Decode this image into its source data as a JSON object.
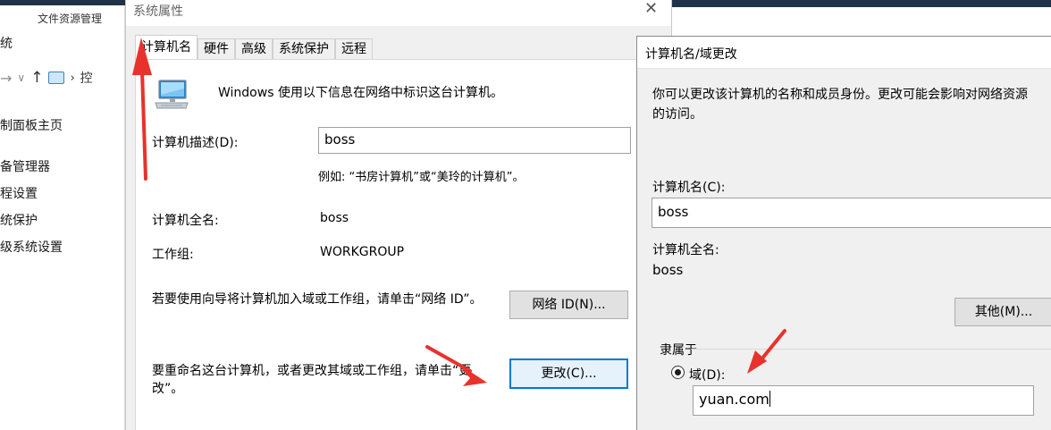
{
  "background": {
    "tab_title": "文件资源管理",
    "title": "统",
    "breadcrumb": "控",
    "links": [
      "制面板主页",
      "备管理器",
      "程设置",
      "统保护",
      "级系统设置"
    ]
  },
  "system_properties": {
    "title": "系统属性",
    "close_glyph": "✕",
    "tabs": [
      "计算机名",
      "硬件",
      "高级",
      "系统保护",
      "远程"
    ],
    "intro": "Windows 使用以下信息在网络中标识这台计算机。",
    "description_label": "计算机描述(D):",
    "description_value": "boss",
    "example": "例如: “书房计算机”或“美玲的计算机”。",
    "full_name_label": "计算机全名:",
    "full_name_value": "boss",
    "workgroup_label": "工作组:",
    "workgroup_value": "WORKGROUP",
    "network_id_text": "若要使用向导将计算机加入域或工作组，请单击“网络 ID”。",
    "network_id_button": "网络 ID(N)...",
    "rename_text": "要重命名这台计算机，或者更改其域或工作组，请单击“更改”。",
    "change_button": "更改(C)..."
  },
  "computer_name_dialog": {
    "title": "计算机名/域更改",
    "description_line1": "你可以更改该计算机的名称和成员身份。更改可能会影响对网络资源",
    "description_line2": "的访问。",
    "computer_name_label": "计算机名(C):",
    "computer_name_value": "boss",
    "full_name_label": "计算机全名:",
    "full_name_value": "boss",
    "more_button": "其他(M)...",
    "member_of_label": "隶属于",
    "domain_label": "域(D):",
    "domain_value": "yuan.com",
    "domain_selected": true
  },
  "colors": {
    "focus_blue": "#0078d7",
    "annotation_red": "#e8322c",
    "dialog_bg": "#f0f0f0"
  }
}
